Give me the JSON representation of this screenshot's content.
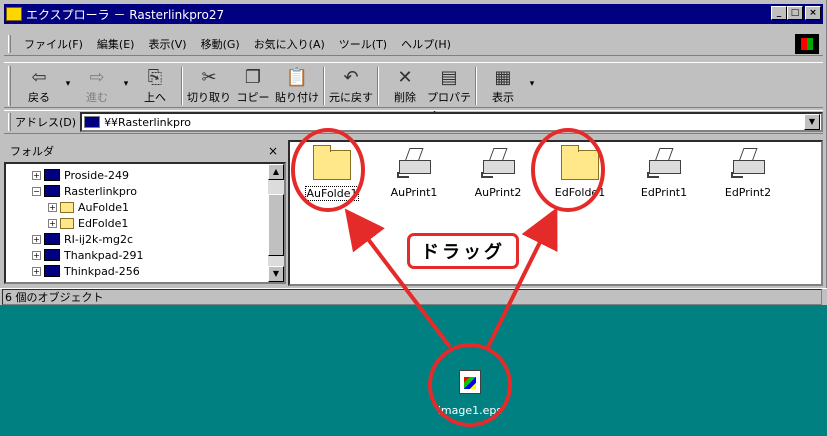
{
  "window": {
    "title": "エクスプローラ － Rasterlinkpro27",
    "buttons": [
      "_",
      "□",
      "×"
    ]
  },
  "menu": [
    "ファイル(F)",
    "編集(E)",
    "表示(V)",
    "移動(G)",
    "お気に入り(A)",
    "ツール(T)",
    "ヘルプ(H)"
  ],
  "toolbar": [
    {
      "label": "戻る",
      "icon": "back-arrow",
      "glyph": "⇦",
      "disabled": false,
      "dropdown": true
    },
    {
      "label": "進む",
      "icon": "forward-arrow",
      "glyph": "⇨",
      "disabled": true,
      "dropdown": true
    },
    {
      "label": "上へ",
      "icon": "up-folder",
      "glyph": "⎘",
      "disabled": false,
      "dropdown": false
    },
    {
      "label": "切り取り",
      "icon": "scissors",
      "glyph": "✂",
      "disabled": false,
      "dropdown": false
    },
    {
      "label": "コピー",
      "icon": "copy",
      "glyph": "❐",
      "disabled": false,
      "dropdown": false
    },
    {
      "label": "貼り付け",
      "icon": "paste",
      "glyph": "📋",
      "disabled": false,
      "dropdown": false
    },
    {
      "label": "元に戻す",
      "icon": "undo",
      "glyph": "↶",
      "disabled": false,
      "dropdown": false
    },
    {
      "label": "削除",
      "icon": "delete-x",
      "glyph": "✕",
      "disabled": false,
      "dropdown": false
    },
    {
      "label": "プロパティ",
      "icon": "properties",
      "glyph": "▤",
      "disabled": false,
      "dropdown": false
    },
    {
      "label": "表示",
      "icon": "view",
      "glyph": "▦",
      "disabled": false,
      "dropdown": true
    }
  ],
  "address": {
    "label": "アドレス(D)",
    "value": "¥¥Rasterlinkpro"
  },
  "folder_pane": {
    "title": "フォルダ",
    "close": "×",
    "tree": [
      {
        "label": "Proside-249",
        "type": "computer",
        "toggle": "+"
      },
      {
        "label": "Rasterlinkpro",
        "type": "computer",
        "toggle": "−"
      },
      {
        "label": "AuFolde1",
        "type": "folder",
        "toggle": "+"
      },
      {
        "label": "EdFolde1",
        "type": "folder",
        "toggle": "+"
      },
      {
        "label": "RI-ij2k-mg2c",
        "type": "computer",
        "toggle": "+"
      },
      {
        "label": "Thankpad-291",
        "type": "computer",
        "toggle": "+"
      },
      {
        "label": "Thinkpad-256",
        "type": "computer",
        "toggle": "+"
      }
    ]
  },
  "items": [
    {
      "label": "AuFolde1",
      "type": "folder"
    },
    {
      "label": "AuPrint1",
      "type": "printer"
    },
    {
      "label": "AuPrint2",
      "type": "printer"
    },
    {
      "label": "EdFolde1",
      "type": "folder"
    },
    {
      "label": "EdPrint1",
      "type": "printer"
    },
    {
      "label": "EdPrint2",
      "type": "printer"
    }
  ],
  "status": "6 個のオブジェクト",
  "desktop_file": {
    "label": "image1.eps"
  },
  "annotation": {
    "text": "ドラッグ",
    "color": "#e52a2a"
  }
}
